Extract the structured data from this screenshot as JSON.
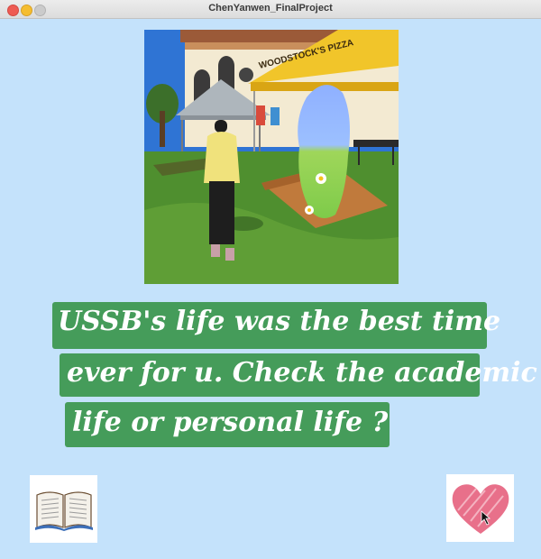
{
  "window": {
    "title": "ChenYanwen_FinalProject"
  },
  "photo": {
    "tent_sign": "WOODSTOCK'S PIZZA"
  },
  "caption": {
    "line1": "USSB's life was the best time",
    "line2": "ever for u. Check the academic",
    "line3": "life or personal life ?"
  },
  "buttons": {
    "academic_icon": "open-book-icon",
    "personal_icon": "heart-icon"
  },
  "colors": {
    "background": "#c4e2fb",
    "caption_band": "#459c5a",
    "heart": "#e8708a"
  }
}
